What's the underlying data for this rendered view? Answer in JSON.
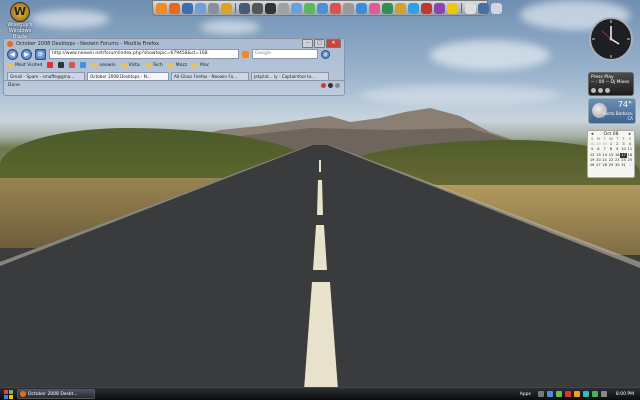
{
  "desktop_icon": {
    "label_line1": "Wiseguy's",
    "label_line2": "Windows",
    "label_line3": "Blade"
  },
  "dock": {
    "icons": [
      "flame-icon",
      "firefox-icon",
      "thunderbird-icon",
      "email-icon",
      "hdd-icon",
      "winamp-icon",
      "network-icon",
      "camera-icon",
      "terminal-icon",
      "tools-icon",
      "paint-icon",
      "recycle-icon",
      "photo-icon",
      "pin-icon",
      "gear-icon",
      "globe-icon",
      "media-icon",
      "earth-icon",
      "chart-icon",
      "skype-icon",
      "calendar-icon",
      "flag-icon",
      "notes-icon",
      "monitor-icon",
      "display-icon",
      "trash-icon"
    ],
    "colors": [
      "#f08a24",
      "#e66a1c",
      "#3b6db3",
      "#6fa0d8",
      "#8a8f99",
      "#e0a020",
      "#4a5a70",
      "#555",
      "#333",
      "#a0a0a0",
      "#6a9fe0",
      "#5cb85c",
      "#4a90d9",
      "#d9534f",
      "#999",
      "#3d8bd9",
      "#e05a9a",
      "#2f8f4f",
      "#d0a030",
      "#2fa0e0",
      "#c0392b",
      "#8e44ad",
      "#f1c40f",
      "#ddd",
      "#4a6fa5",
      "#cfd6df"
    ]
  },
  "browser": {
    "title": "October 2008 Desktops - Neowin Forums - Mozilla Firefox",
    "url": "http://www.neowin.net/forum/index.php?showtopic=679458&st=168",
    "search_placeholder": "Google",
    "bookmarks": [
      "Most Visited",
      "",
      "",
      "",
      "",
      "neowin",
      "Vista",
      "Tech",
      "Mozz",
      "Mac"
    ],
    "tabs": [
      {
        "label": "Gmail - Spam - smaffe@gma...",
        "active": false
      },
      {
        "label": "October 2008 Desktops - N...",
        "active": true
      },
      {
        "label": "All-Glass Firefox - Neowin Fo...",
        "active": false
      },
      {
        "label": "Jetpilot... ly - Captainfool to...",
        "active": false
      }
    ],
    "status": "Done"
  },
  "media": {
    "title": "Press Play",
    "track": "-- : 00 -- Dj Mixes"
  },
  "weather": {
    "temp": "74°",
    "location": "Santa Barbara, CA"
  },
  "calendar": {
    "month": "Oct 08",
    "dows": [
      "S",
      "M",
      "T",
      "W",
      "T",
      "F",
      "S"
    ],
    "days": [
      "28",
      "29",
      "30",
      "1",
      "2",
      "3",
      "4",
      "5",
      "6",
      "7",
      "8",
      "9",
      "10",
      "11",
      "12",
      "13",
      "14",
      "15",
      "16",
      "17",
      "18",
      "19",
      "20",
      "21",
      "22",
      "23",
      "24",
      "25",
      "26",
      "27",
      "28",
      "29",
      "30",
      "31",
      "1"
    ],
    "today": "17"
  },
  "taskbar": {
    "item_label": "October 2008 Deskt...",
    "apps_label": "Apps",
    "time": "8:00 PM"
  }
}
